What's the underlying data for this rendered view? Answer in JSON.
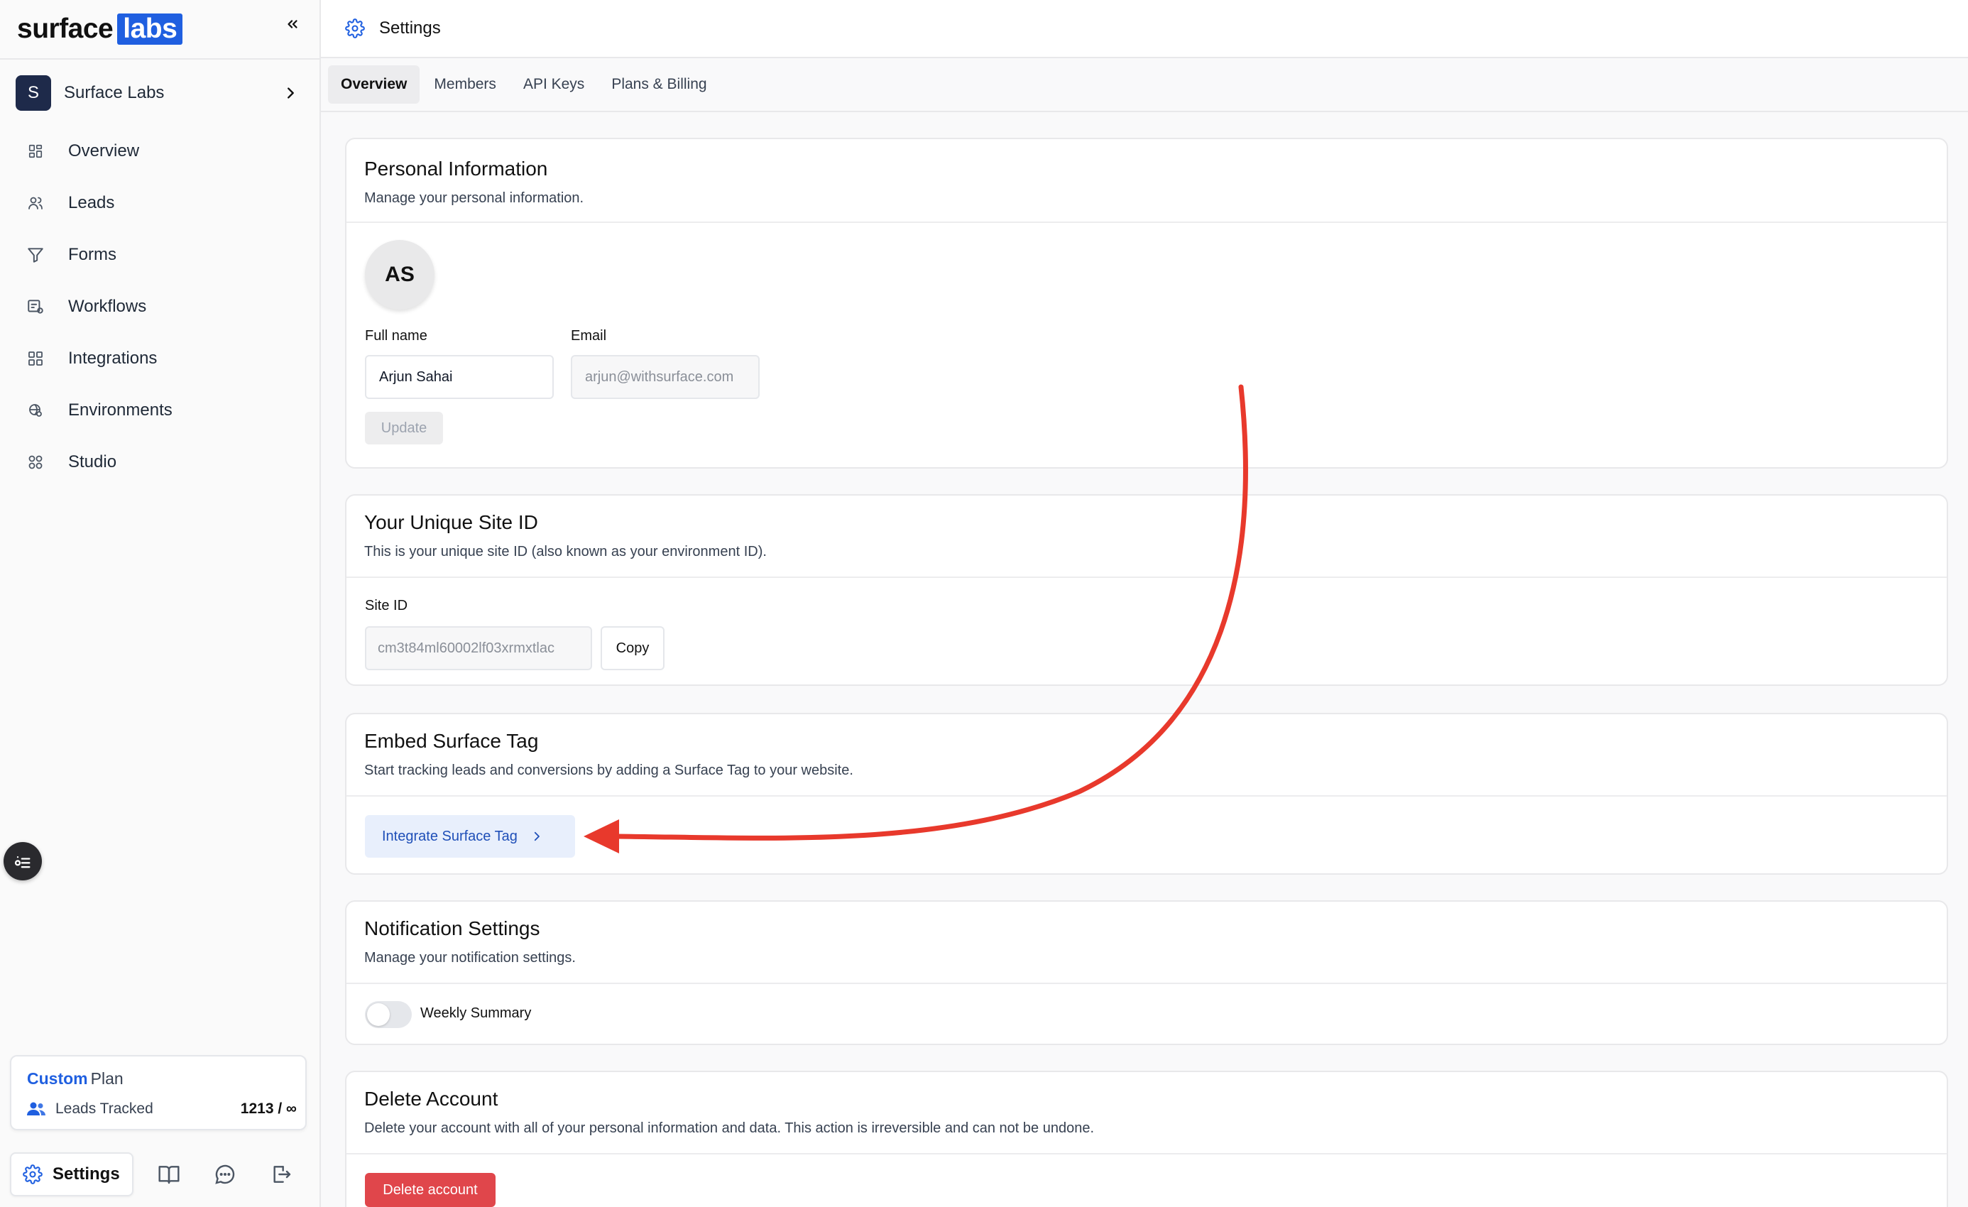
{
  "sidebar": {
    "logo": {
      "word": "surface",
      "badge": "labs"
    },
    "collapse_icon": "double-chevron-left-icon",
    "workspace": {
      "initial": "S",
      "name": "Surface Labs"
    },
    "nav": [
      {
        "label": "Overview",
        "icon": "grid-icon"
      },
      {
        "label": "Leads",
        "icon": "users-icon"
      },
      {
        "label": "Forms",
        "icon": "filter-icon"
      },
      {
        "label": "Workflows",
        "icon": "workflow-icon"
      },
      {
        "label": "Integrations",
        "icon": "integrations-icon"
      },
      {
        "label": "Environments",
        "icon": "environment-icon"
      },
      {
        "label": "Studio",
        "icon": "studio-icon"
      }
    ],
    "plan": {
      "name_highlight": "Custom",
      "name_rest": "Plan",
      "leads_label": "Leads Tracked",
      "leads_count": "1213 / ∞"
    },
    "bottom": {
      "settings_label": "Settings"
    }
  },
  "topbar": {
    "title": "Settings"
  },
  "tabs": [
    {
      "label": "Overview",
      "active": true
    },
    {
      "label": "Members",
      "active": false
    },
    {
      "label": "API Keys",
      "active": false
    },
    {
      "label": "Plans & Billing",
      "active": false
    }
  ],
  "personal": {
    "title": "Personal Information",
    "description": "Manage your personal information.",
    "avatar_initials": "AS",
    "full_name_label": "Full name",
    "full_name_value": "Arjun Sahai",
    "email_label": "Email",
    "email_value": "arjun@withsurface.com",
    "update_label": "Update"
  },
  "site_id": {
    "title": "Your Unique Site ID",
    "description": "This is your unique site ID (also known as your environment ID).",
    "label": "Site ID",
    "value": "cm3t84ml60002lf03xrmxtlac",
    "copy_label": "Copy"
  },
  "embed": {
    "title": "Embed Surface Tag",
    "description": "Start tracking leads and conversions by adding a Surface Tag to your website.",
    "button_label": "Integrate Surface Tag"
  },
  "notifications": {
    "title": "Notification Settings",
    "description": "Manage your notification settings.",
    "toggle_label": "Weekly Summary",
    "toggle_on": false
  },
  "delete": {
    "title": "Delete Account",
    "description": "Delete your account with all of your personal information and data. This action is irreversible and can not be undone.",
    "button_label": "Delete account"
  },
  "colors": {
    "accent": "#1f5fe0",
    "danger": "#e0464b",
    "annotation_arrow": "#e8392c"
  }
}
